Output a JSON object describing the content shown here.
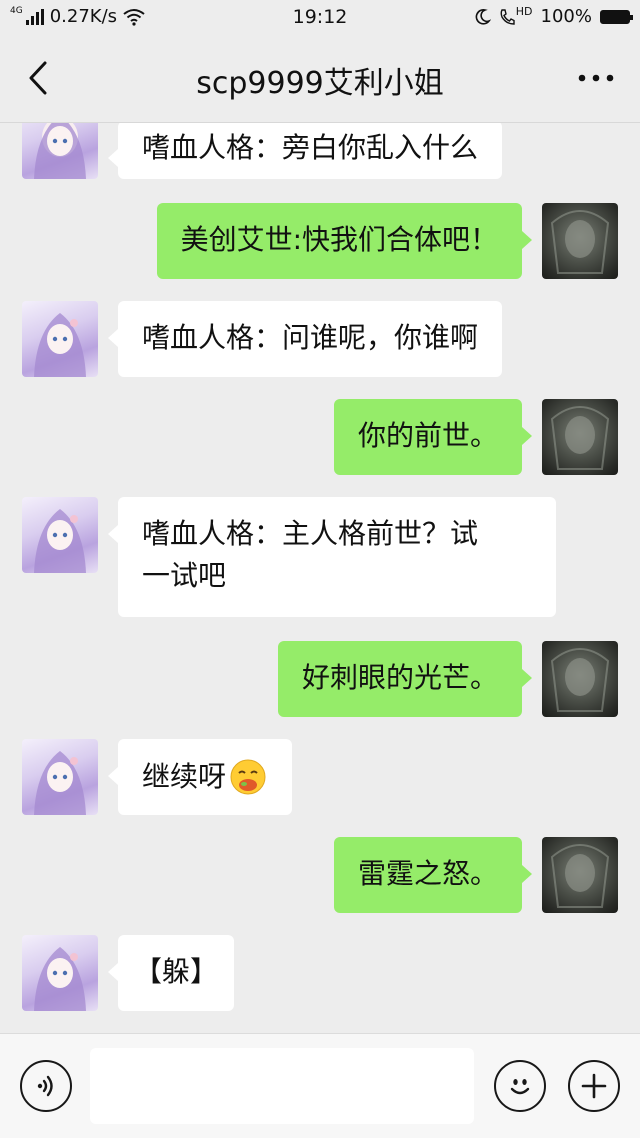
{
  "status_bar": {
    "network_type": "4G",
    "speed": "0.27K/s",
    "time": "19:12",
    "hd_label": "HD",
    "battery": "100%"
  },
  "nav": {
    "title": "scp9999艾利小姐",
    "back_icon": "chevron-left-icon",
    "more_icon": "more-dots-icon"
  },
  "messages": [
    {
      "side": "in",
      "text": "嗜血人格：旁白你乱入什么"
    },
    {
      "side": "out",
      "text": "美创艾世:快我们合体吧！"
    },
    {
      "side": "in",
      "text": "嗜血人格：问谁呢，你谁啊"
    },
    {
      "side": "out",
      "text": "你的前世。"
    },
    {
      "side": "in",
      "text": "嗜血人格：主人格前世？试\n一试吧"
    },
    {
      "side": "out",
      "text": "好刺眼的光芒。"
    },
    {
      "side": "in",
      "text": "继续呀",
      "emoji": "eating-emoji"
    },
    {
      "side": "out",
      "text": "雷霆之怒。"
    },
    {
      "side": "in",
      "text": "【躲】"
    }
  ],
  "input_bar": {
    "voice_icon": "voice-icon",
    "emoji_icon": "emoji-icon",
    "plus_icon": "plus-icon",
    "value": ""
  },
  "colors": {
    "background": "#ededed",
    "bubble_in": "#ffffff",
    "bubble_out": "#95ec69"
  }
}
